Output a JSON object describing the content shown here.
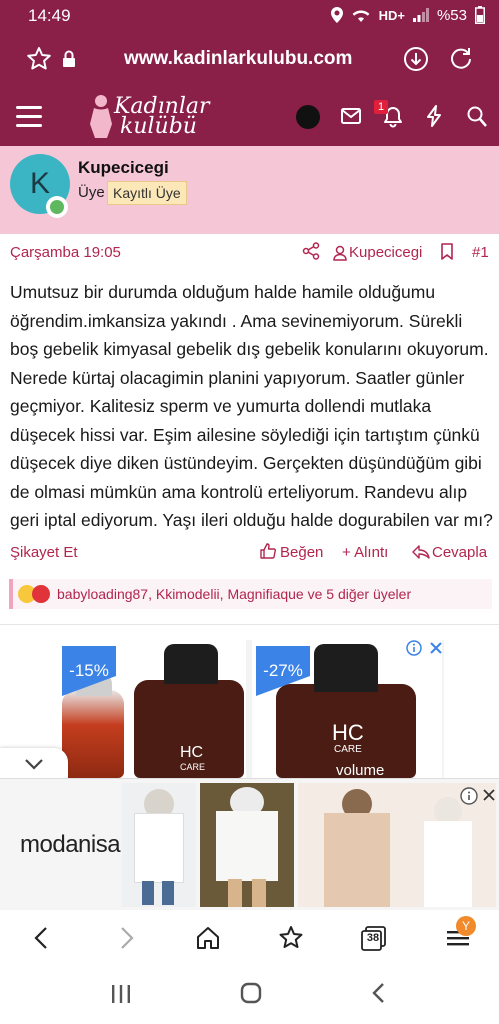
{
  "status_bar": {
    "time": "14:49",
    "network": "HD+",
    "battery": "%53"
  },
  "browser": {
    "url": "www.kadinlarkulubu.com"
  },
  "site": {
    "logo_line1": "Kadınlar",
    "logo_line2": "kulübü",
    "notification_count": "1"
  },
  "profile": {
    "avatar_letter": "K",
    "username": "Kupecicegi",
    "role": "Üye",
    "badge": "Kayıtlı Üye"
  },
  "post_meta": {
    "date": "Çarşamba 19:05",
    "author": "Kupecicegi",
    "post_number": "#1"
  },
  "post": {
    "body": "Umutsuz bir durumda olduğum halde hamile olduğumu öğrendim.imkansiza yakındı . Ama sevinemiyorum. Sürekli boş gebelik kimyasal gebelik dış gebelik konularını okuyorum. Nerede kürtaj olacagimin planini yapıyorum. Saatler günler geçmiyor. Kalitesiz sperm ve yumurta dollendi mutlaka düşecek hissi var. Eşim ailesine söylediği için tartıştım çünkü düşecek diye diken üstündeyim. Gerçekten düşündüğüm gibi de olmasi mümkün ama kontrolü erteliyorum. Randevu alıp geri iptal ediyorum. Yaşı ileri olduğu halde dogurabilen var mı?"
  },
  "actions": {
    "report": "Şikayet Et",
    "like": "Beğen",
    "quote": "+ Alıntı",
    "reply": "Cevapla"
  },
  "reactions": {
    "text": "babyloading87, Kkimodelii, Magnifiaque ve 5 diğer üyeler"
  },
  "ad_top": {
    "discount_left": "-15%",
    "discount_right": "-27%",
    "product_brand": "HC",
    "product_sub": "CARE",
    "product_word": "volume"
  },
  "ad_bottom": {
    "brand": "modanisa"
  },
  "browser_nav": {
    "tabs_count": "38",
    "profile_letter": "Y"
  },
  "colors": {
    "brand": "#8a1f47",
    "accent": "#b2254f",
    "profile_bg": "#f4c6d6"
  }
}
